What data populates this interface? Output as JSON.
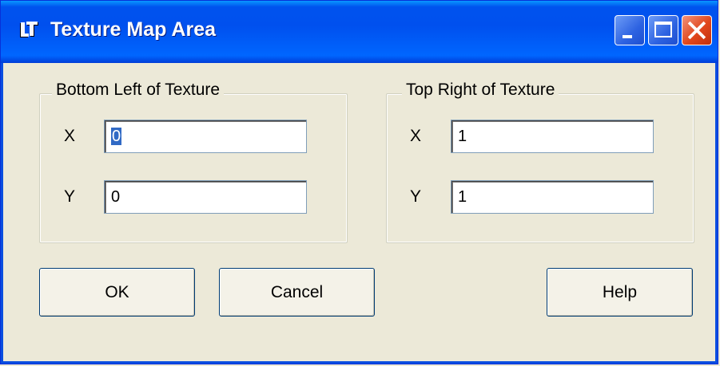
{
  "window": {
    "title": "Texture Map Area",
    "app_icon": "lt-app-icon",
    "controls": {
      "minimize_icon": "minimize-icon",
      "maximize_icon": "maximize-icon",
      "close_icon": "close-icon"
    }
  },
  "bottom_left": {
    "legend": "Bottom Left of Texture",
    "x_label": "X",
    "x_value": "0",
    "y_label": "Y",
    "y_value": "0"
  },
  "top_right": {
    "legend": "Top Right of Texture",
    "x_label": "X",
    "x_value": "1",
    "y_label": "Y",
    "y_value": "1"
  },
  "buttons": {
    "ok": "OK",
    "cancel": "Cancel",
    "help": "Help"
  },
  "colors": {
    "titlebar": "#0055ea",
    "dialog_bg": "#ece9d8",
    "selection": "#316ac5",
    "close_button": "#e1471d"
  }
}
